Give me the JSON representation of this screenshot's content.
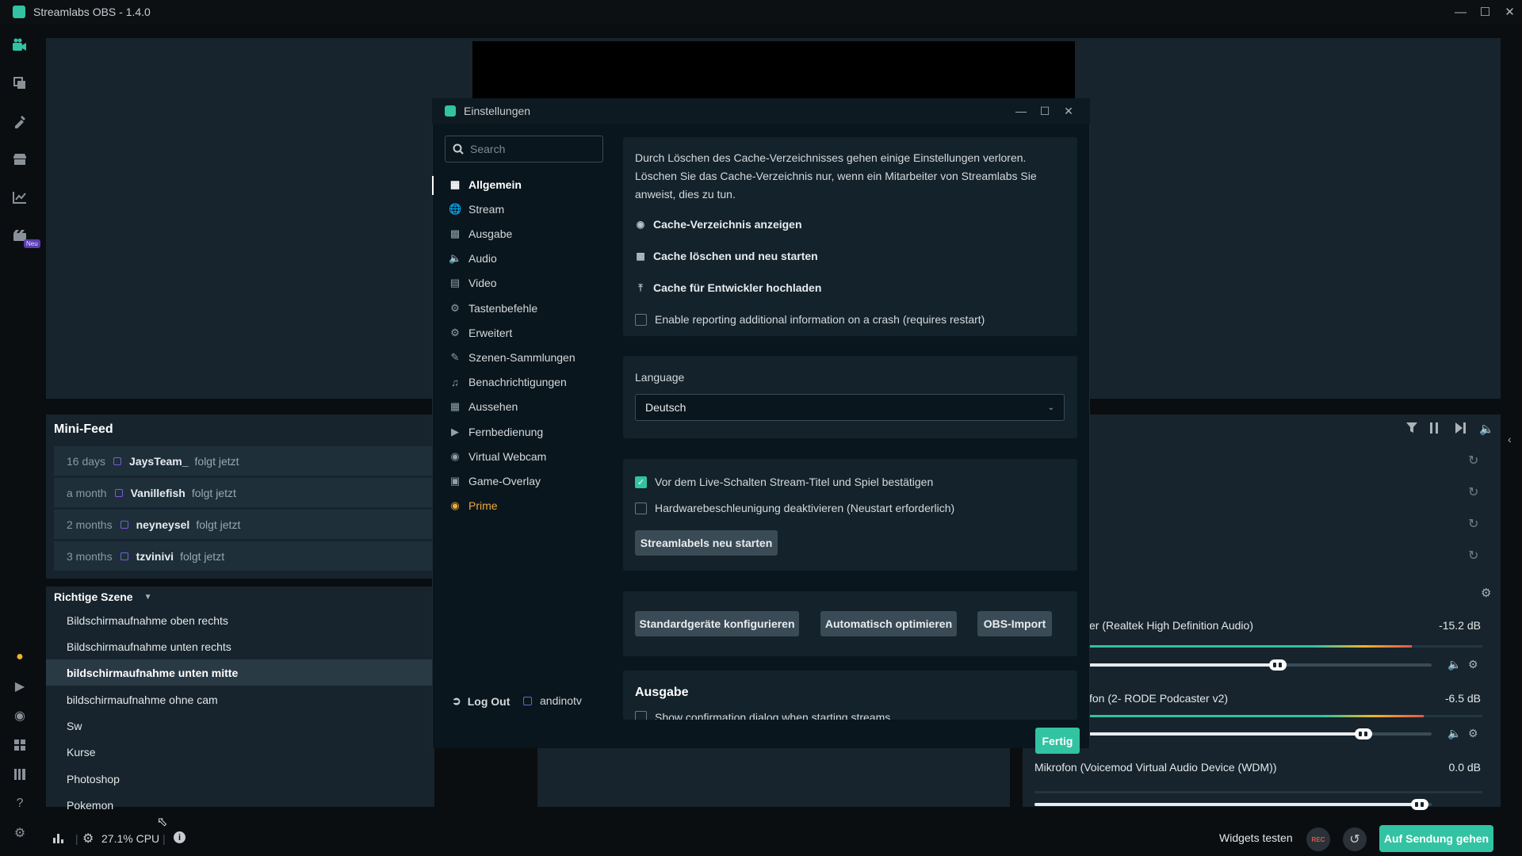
{
  "app": {
    "title": "Streamlabs OBS - 1.4.0"
  },
  "leftnav": {
    "new_badge": "Neu"
  },
  "minifeed": {
    "title": "Mini-Feed",
    "items": [
      {
        "time": "16 days",
        "user": "JaysTeam_",
        "action": "folgt jetzt"
      },
      {
        "time": "a month",
        "user": "Vanillefish",
        "action": "folgt jetzt"
      },
      {
        "time": "2 months",
        "user": "neyneysel",
        "action": "folgt jetzt"
      },
      {
        "time": "3 months",
        "user": "tzvinivi",
        "action": "folgt jetzt"
      }
    ]
  },
  "scenes": {
    "collection": "Richtige Szene",
    "items": [
      "Bildschirmaufnahme oben rechts",
      "Bildschirmaufnahme unten rechts",
      "bildschirmaufnahme unten mitte",
      "bildschirmaufnahme ohne cam",
      "Sw",
      "Kurse",
      "Photoshop",
      "Pokemon"
    ],
    "active_index": 2
  },
  "mixer": {
    "channels": [
      {
        "name": "er (Realtek High Definition Audio)",
        "db": "-15.2 dB",
        "level": 0.82,
        "volume": 0.55
      },
      {
        "name": "fon (2- RODE Podcaster v2)",
        "db": "-6.5 dB",
        "level": 0.85,
        "volume": 0.8
      },
      {
        "name": "Mikrofon (Voicemod Virtual Audio Device (WDM))",
        "db": "0.0 dB",
        "level": 0.0,
        "volume": 0.97
      }
    ]
  },
  "statusbar": {
    "cpu": "27.1% CPU",
    "widgets": "Widgets testen",
    "rec": "REC",
    "go_live": "Auf Sendung gehen"
  },
  "settings": {
    "title": "Einstellungen",
    "search_placeholder": "Search",
    "nav": [
      {
        "label": "Allgemein",
        "icon": "grid-icon"
      },
      {
        "label": "Stream",
        "icon": "globe-icon"
      },
      {
        "label": "Ausgabe",
        "icon": "document-icon"
      },
      {
        "label": "Audio",
        "icon": "speaker-icon"
      },
      {
        "label": "Video",
        "icon": "film-icon"
      },
      {
        "label": "Tastenbefehle",
        "icon": "keyboard-icon"
      },
      {
        "label": "Erweitert",
        "icon": "gears-icon"
      },
      {
        "label": "Szenen-Sammlungen",
        "icon": "collection-icon"
      },
      {
        "label": "Benachrichtigungen",
        "icon": "bell-icon"
      },
      {
        "label": "Aussehen",
        "icon": "palette-icon"
      },
      {
        "label": "Fernbedienung",
        "icon": "remote-icon"
      },
      {
        "label": "Virtual Webcam",
        "icon": "camera-icon"
      },
      {
        "label": "Game-Overlay",
        "icon": "overlay-icon"
      },
      {
        "label": "Prime",
        "icon": "prime-icon"
      }
    ],
    "active_nav": "Allgemein",
    "logout": "Log Out",
    "account": "andinotv",
    "cache": {
      "description": "Durch Löschen des Cache-Verzeichnisses gehen einige Einstellungen verloren. Löschen Sie das Cache-Verzeichnis nur, wenn ein Mitarbeiter von Streamlabs Sie anweist, dies zu tun.",
      "show": "Cache-Verzeichnis anzeigen",
      "clear": "Cache löschen und neu starten",
      "upload": "Cache für Entwickler hochladen",
      "report_label": "Enable reporting additional information on a crash (requires restart)",
      "report_checked": false
    },
    "language": {
      "label": "Language",
      "value": "Deutsch"
    },
    "confirm_title": {
      "label": "Vor dem Live-Schalten Stream-Titel und Spiel bestätigen",
      "checked": true
    },
    "hw_accel": {
      "label": "Hardwarebeschleunigung deaktivieren (Neustart erforderlich)",
      "checked": false
    },
    "restart_labels": "Streamlabels neu starten",
    "buttons": {
      "configure": "Standardgeräte konfigurieren",
      "optimize": "Automatisch optimieren",
      "obs_import": "OBS-Import"
    },
    "output_section": "Ausgabe",
    "output_confirm": "Show confirmation dialog when starting streams",
    "done": "Fertig"
  }
}
